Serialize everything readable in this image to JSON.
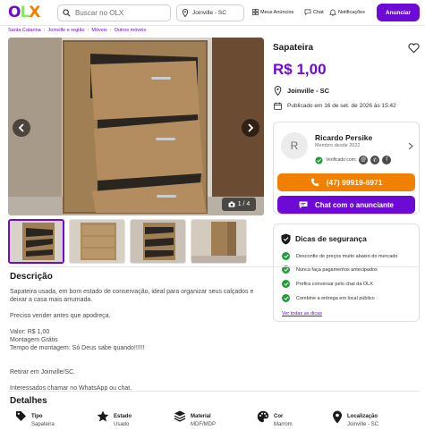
{
  "header": {
    "search_placeholder": "Buscar no OLX",
    "location": "Joinville - SC",
    "nav": [
      "Meus Anúncios",
      "Chat",
      "Notificações"
    ],
    "cta": "Anunciar"
  },
  "breadcrumb": [
    "Santa Catarina",
    "Joinville e região",
    "Móveis",
    "Outros móveis"
  ],
  "gallery": {
    "counter": "1 / 4"
  },
  "ad": {
    "title": "Sapateira",
    "price": "R$ 1,00",
    "city": "Joinville - SC",
    "published": "Publicado em 16 de set. de 2026 às 15:42"
  },
  "seller": {
    "initial": "R",
    "name": "Ricardo Persike",
    "since": "Membro desde 2022",
    "verified_label": "Verificado com:",
    "phone": "(47) 99919-6971",
    "chat_label": "Chat com o anunciante"
  },
  "safety": {
    "title": "Dicas de segurança",
    "tips": [
      "Desconfie de preços muito abaixo do mercado",
      "Nunca faça pagamentos antecipados",
      "Prefira conversar pelo chat da OLX",
      "Combine a entrega em local público"
    ],
    "link": "Ver todas as dicas"
  },
  "description": {
    "title": "Descrição",
    "text": "Sapateira usada, em bom estado de conservação, ideal para organizar seus calçados e deixar a casa mais arrumada.\n\nPreciso vender antes que apodreça.\n\nValor: R$ 1,00\nMontagem Grátis\nTempo de montagem: Só Deus sabe quando!!!!!!\n\n\nRetirar em Joinville/SC.\n\nInteressados chamar no WhatsApp ou chat."
  },
  "details": {
    "title": "Detalhes",
    "items": [
      {
        "label": "Tipo",
        "value": "Sapateira",
        "icon": "tag-icon"
      },
      {
        "label": "Estado",
        "value": "Usado",
        "icon": "star-icon"
      },
      {
        "label": "Material",
        "value": "MDF/MDP",
        "icon": "layers-icon"
      },
      {
        "label": "Cor",
        "value": "Marrom",
        "icon": "palette-icon"
      },
      {
        "label": "Localização",
        "value": "Joinville - SC",
        "icon": "location-pin-icon"
      }
    ]
  },
  "colors": {
    "brand_purple": "#6e0ad6",
    "orange": "#f28000",
    "green": "#8ce563",
    "check_green": "#1e9e3a"
  }
}
